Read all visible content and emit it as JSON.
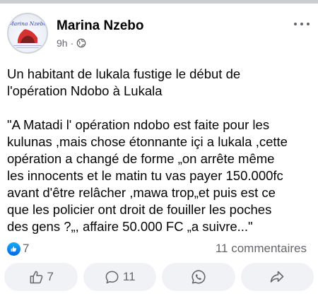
{
  "post": {
    "author_name": "Marina Nzebo",
    "time": "9h",
    "meta_separator": "·",
    "audience_icon": "globe-icon",
    "avatar_caption": "Marina Nzebo",
    "title_text": "Un habitant de lukala fustige le début de\nl'opération Ndobo à Lukala",
    "quote_text": "\"A Matadi l' opération ndobo est faite pour les\nkulunas ,mais chose étonnante içi a lukala ,cette\nopération a changé de forme „on arrête même\nles innocents et le matin tu vas payer 150.000fc\navant d'être relâcher ,mawa trop„et puis est ce\nque les policier ont  droit de fouiller les poches\ndes gens ?„, affaire 50.000 FC „a suivre...\""
  },
  "stats": {
    "reaction_icon": "like-icon",
    "reactions_count": "7",
    "comments_label": "11 commentaires"
  },
  "actions": {
    "like_count": "7",
    "comment_count": "11",
    "whatsapp_icon": "whatsapp-icon",
    "share_icon": "share-icon"
  },
  "colors": {
    "text_primary": "#050505",
    "text_secondary": "#65676b",
    "like_blue": "#0866ff",
    "pill_background": "#f0f2f5"
  }
}
